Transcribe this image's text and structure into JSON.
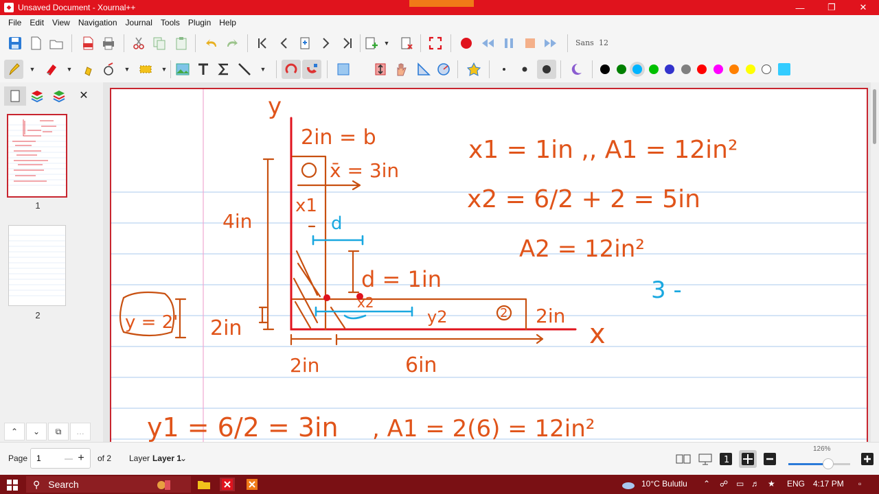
{
  "window": {
    "title": "Unsaved Document - Xournal++"
  },
  "menu": [
    "File",
    "Edit",
    "View",
    "Navigation",
    "Journal",
    "Tools",
    "Plugin",
    "Help"
  ],
  "toolbar": {
    "font_name": "Sans",
    "font_size": "12"
  },
  "palette": [
    "#000000",
    "#008000",
    "#00b4ff",
    "#00c000",
    "#3333cc",
    "#808080",
    "#ff0000",
    "#ff00ff",
    "#ff8000",
    "#ffff00",
    "#ffffff",
    "#33ccff"
  ],
  "sidebar": {
    "pages": [
      {
        "number": "1"
      },
      {
        "number": "2"
      }
    ]
  },
  "note": {
    "lines": [
      "y",
      "2in = b",
      "x̄ = 3in",
      "x1",
      "4in",
      "d",
      "d = 1in",
      "y = 2'",
      "2in",
      "x2",
      "y2",
      "2",
      "2in",
      "x",
      "2in",
      "6in",
      "x1 = 1in ,, A1 = 12in²",
      "x2 = 6/2 + 2 = 5in",
      "A2 = 12in²",
      "3 -",
      "y1 = 6/2 = 3in",
      ", A1 = 2(6) = 12in²",
      "1"
    ]
  },
  "status": {
    "page_label": "Page",
    "page_value": "1",
    "of_pages": "of 2",
    "layer_label": "Layer",
    "layer_value": "Layer 1",
    "zoom": "126%"
  },
  "taskbar": {
    "search": "Search",
    "weather": "10°C  Bulutlu",
    "lang": "ENG",
    "time": "4:17 PM"
  }
}
